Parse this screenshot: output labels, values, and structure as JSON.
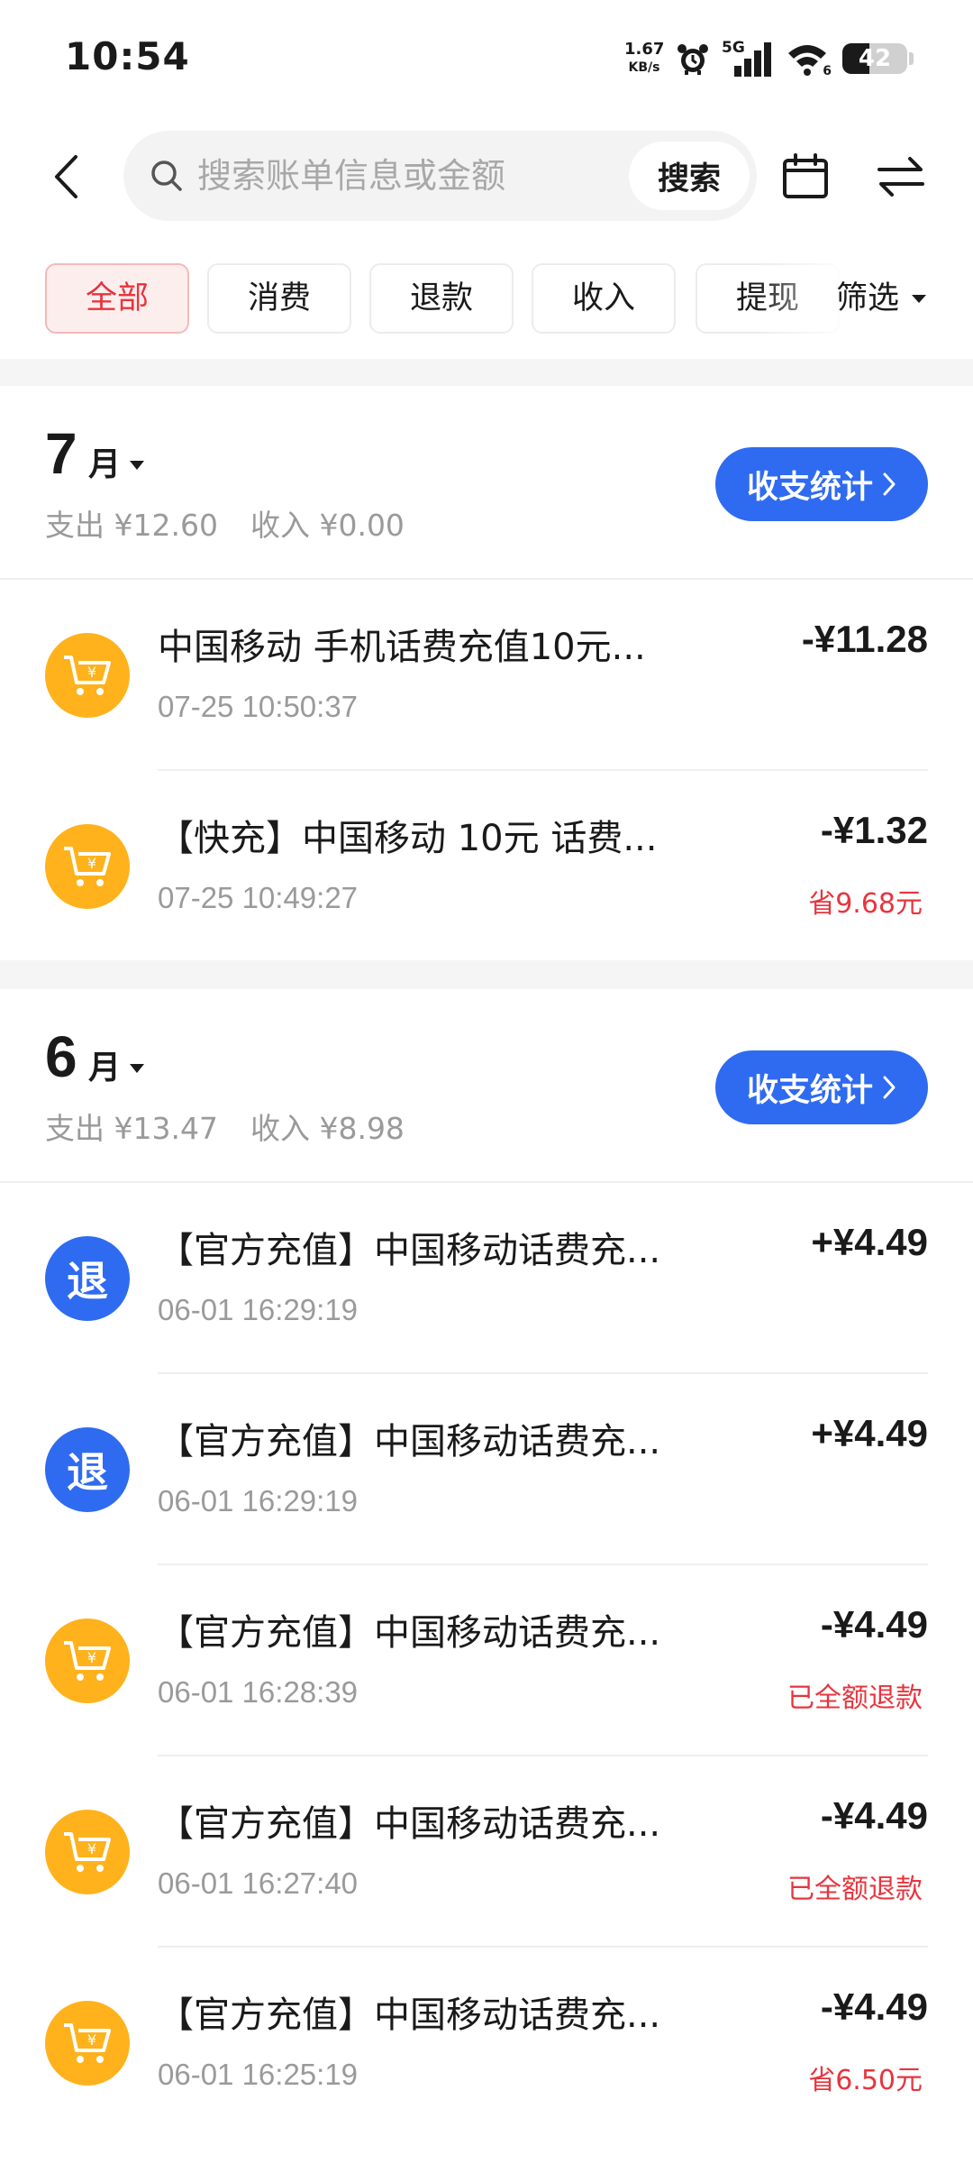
{
  "status_bar": {
    "time": "10:54",
    "net_speed_value": "1.67",
    "net_speed_unit": "KB/s",
    "network_label": "5G",
    "wifi_sub": "6",
    "battery": "42",
    "battery_level_percent": 42
  },
  "header": {
    "search_placeholder": "搜索账单信息或金额",
    "search_button": "搜索"
  },
  "filters": {
    "tabs": [
      "全部",
      "消费",
      "退款",
      "收入",
      "提现"
    ],
    "active_index": 0,
    "select_label": "筛选"
  },
  "colors": {
    "accent_red": "#e8343d",
    "accent_blue": "#2f6bf0",
    "cart_orange": "#ffb21c"
  },
  "months": [
    {
      "month": "7",
      "unit": "月",
      "expense": "支出 ¥12.60",
      "income": "收入 ¥0.00",
      "stats_button": "收支统计",
      "transactions": [
        {
          "icon": "cart-icon",
          "title": "中国移动 手机话费充值10元...",
          "time": "07-25 10:50:37",
          "amount": "-¥11.28",
          "note": ""
        },
        {
          "icon": "cart-icon",
          "title": "【快充】中国移动 10元 话费...",
          "time": "07-25 10:49:27",
          "amount": "-¥1.32",
          "note": "省9.68元"
        }
      ]
    },
    {
      "month": "6",
      "unit": "月",
      "expense": "支出 ¥13.47",
      "income": "收入 ¥8.98",
      "stats_button": "收支统计",
      "transactions": [
        {
          "icon": "refund-icon",
          "icon_text": "退",
          "title": "【官方充值】中国移动话费充...",
          "time": "06-01 16:29:19",
          "amount": "+¥4.49",
          "note": ""
        },
        {
          "icon": "refund-icon",
          "icon_text": "退",
          "title": "【官方充值】中国移动话费充...",
          "time": "06-01 16:29:19",
          "amount": "+¥4.49",
          "note": ""
        },
        {
          "icon": "cart-icon",
          "title": "【官方充值】中国移动话费充...",
          "time": "06-01 16:28:39",
          "amount": "-¥4.49",
          "note": "已全额退款"
        },
        {
          "icon": "cart-icon",
          "title": "【官方充值】中国移动话费充...",
          "time": "06-01 16:27:40",
          "amount": "-¥4.49",
          "note": "已全额退款"
        },
        {
          "icon": "cart-icon",
          "title": "【官方充值】中国移动话费充...",
          "time": "06-01 16:25:19",
          "amount": "-¥4.49",
          "note": "省6.50元"
        }
      ]
    }
  ]
}
